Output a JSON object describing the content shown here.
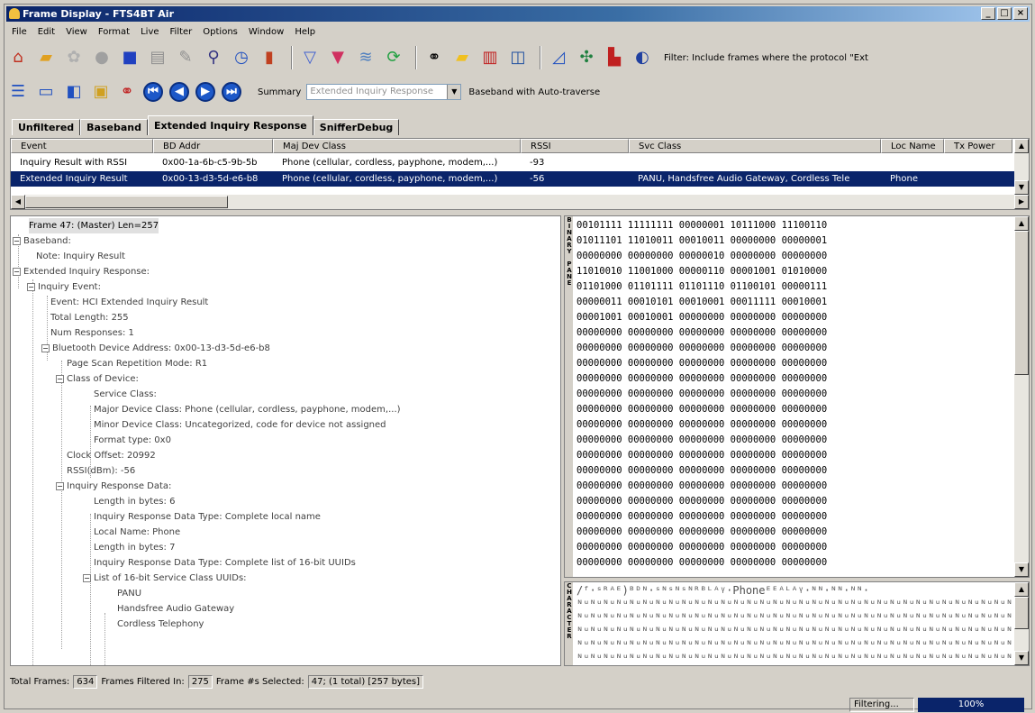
{
  "window": {
    "title": "Frame Display - FTS4BT Air",
    "controls": [
      "_",
      "□",
      "×"
    ]
  },
  "menu": [
    "File",
    "Edit",
    "View",
    "Format",
    "Live",
    "Filter",
    "Options",
    "Window",
    "Help"
  ],
  "toolbar1": {
    "filter_text": "Filter:  Include frames where the protocol \"Ext"
  },
  "toolbar2": {
    "summary_label": "Summary",
    "summary_value": "Extended Inquiry Response",
    "baseband_label": "Baseband with Auto-traverse"
  },
  "tabs": [
    "Unfiltered",
    "Baseband",
    "Extended Inquiry Response",
    "SnifferDebug"
  ],
  "grid": {
    "columns": [
      "Event",
      "BD Addr",
      "Maj Dev Class",
      "RSSI",
      "Svc Class",
      "Loc Name",
      "Tx Power"
    ],
    "rows": [
      {
        "event": "Inquiry Result with RSSI",
        "bdaddr": "0x00-1a-6b-c5-9b-5b",
        "majdev": "Phone (cellular, cordless, payphone, modem,...)",
        "rssi": "-93",
        "svc": "",
        "loc": "",
        "tx": ""
      },
      {
        "event": "Extended Inquiry Result",
        "bdaddr": "0x00-13-d3-5d-e6-b8",
        "majdev": "Phone (cellular, cordless, payphone, modem,...)",
        "rssi": "-56",
        "svc": "PANU, Handsfree Audio Gateway, Cordless Tele",
        "loc": "Phone",
        "tx": ""
      }
    ]
  },
  "tree": [
    "Frame 47: (Master) Len=257",
    "Baseband:",
    "Note: Inquiry Result",
    "Extended Inquiry Response:",
    "Inquiry Event:",
    "Event: HCI Extended Inquiry Result",
    "Total Length: 255",
    "Num Responses: 1",
    "Bluetooth Device Address: 0x00-13-d3-5d-e6-b8",
    "Page Scan Repetition Mode: R1",
    "Class of Device:",
    "Service Class:",
    "Major Device Class: Phone (cellular, cordless, payphone, modem,...)",
    "Minor Device Class: Uncategorized, code for device not assigned",
    "Format type: 0x0",
    "Clock Offset: 20992",
    "RSSI(dBm): -56",
    "Inquiry Response Data:",
    "Length in bytes: 6",
    "Inquiry Response Data Type: Complete local name",
    "Local Name: Phone",
    "Length in bytes: 7",
    "Inquiry Response Data Type: Complete list of 16-bit UUIDs",
    "List of 16-bit Service Class UUIDs:",
    "PANU",
    "Handsfree Audio Gateway",
    "Cordless Telephony"
  ],
  "binary_label": "BINARY PANE",
  "binary_lines": [
    "00101111 11111111 00000001 10111000 11100110",
    "01011101 11010011 00010011 00000000 00000001",
    "00000000 00000000 00000010 00000000 00000000",
    "11010010 11001000 00000110 00001001 01010000",
    "01101000 01101111 01101110 01100101 00000111",
    "00000011 00010101 00010001 00011111 00010001",
    "00001001 00010001 00000000 00000000 00000000",
    "00000000 00000000 00000000 00000000 00000000",
    "00000000 00000000 00000000 00000000 00000000",
    "00000000 00000000 00000000 00000000 00000000",
    "00000000 00000000 00000000 00000000 00000000",
    "00000000 00000000 00000000 00000000 00000000",
    "00000000 00000000 00000000 00000000 00000000",
    "00000000 00000000 00000000 00000000 00000000",
    "00000000 00000000 00000000 00000000 00000000",
    "00000000 00000000 00000000 00000000 00000000",
    "00000000 00000000 00000000 00000000 00000000",
    "00000000 00000000 00000000 00000000 00000000",
    "00000000 00000000 00000000 00000000 00000000",
    "00000000 00000000 00000000 00000000 00000000",
    "00000000 00000000 00000000 00000000 00000000",
    "00000000 00000000 00000000 00000000 00000000",
    "00000000 00000000 00000000 00000000 00000000"
  ],
  "character_label": "CHARACTER",
  "character_lines": [
    "/ᶠ·ˢᴿᴬᴱ)ᴮᴰᴺ·ˢᴺˢᴺˢᴺᴿᴮᴸᴬᵞ·Phoneᴱᴱᴬᴸᴬᵞ·ᴺᴺ·ᴺᴺ·ᴺᴺ·",
    "ᴺᵘᴺᵘᴺᵘᴺᵘᴺᵘᴺᵘᴺᵘᴺᵘᴺᵘᴺᵘᴺᵘᴺᵘᴺᵘᴺᵘᴺᵘᴺᵘᴺᵘᴺᵘᴺᵘᴺᵘᴺᵘᴺᵘᴺᵘᴺᵘᴺᵘᴺᵘᴺᵘᴺᵘᴺᵘᴺᵘᴺᵘᴺᵘᴺᵘᴺᵘᴺᵘ",
    "ᴺᵘᴺᵘᴺᵘᴺᵘᴺᵘᴺᵘᴺᵘᴺᵘᴺᵘᴺᵘᴺᵘᴺᵘᴺᵘᴺᵘᴺᵘᴺᵘᴺᵘᴺᵘᴺᵘᴺᵘᴺᵘᴺᵘᴺᵘᴺᵘᴺᵘᴺᵘᴺᵘᴺᵘᴺᵘᴺᵘᴺᵘᴺᵘᴺᵘᴺᵘᴺᵘ",
    "ᴺᵘᴺᵘᴺᵘᴺᵘᴺᵘᴺᵘᴺᵘᴺᵘᴺᵘᴺᵘᴺᵘᴺᵘᴺᵘᴺᵘᴺᵘᴺᵘᴺᵘᴺᵘᴺᵘᴺᵘᴺᵘᴺᵘᴺᵘᴺᵘᴺᵘᴺᵘᴺᵘᴺᵘᴺᵘᴺᵘᴺᵘᴺᵘᴺᵘᴺᵘᴺᵘ",
    "ᴺᵘᴺᵘᴺᵘᴺᵘᴺᵘᴺᵘᴺᵘᴺᵘᴺᵘᴺᵘᴺᵘᴺᵘᴺᵘᴺᵘᴺᵘᴺᵘᴺᵘᴺᵘᴺᵘᴺᵘᴺᵘᴺᵘᴺᵘᴺᵘᴺᵘᴺᵘᴺᵘᴺᵘᴺᵘᴺᵘᴺᵘᴺᵘᴺᵘᴺᵘᴺᵘ",
    "ᴺᵘᴺᵘᴺᵘᴺᵘᴺᵘᴺᵘᴺᵘᴺᵘᴺᵘᴺᵘᴺᵘᴺᵘᴺᵘᴺᵘᴺᵘᴺᵘᴺᵘᴺᵘᴺᵘᴺᵘᴺᵘᴺᵘᴺᵘᴺᵘᴺᵘᴺᵘᴺᵘᴺᵘᴺᵘᴺᵘᴺᵘᴺᵘᴺᵘᴺᵘᴺᵘ"
  ],
  "status": {
    "total_frames_label": "Total Frames:",
    "total_frames": "634",
    "filtered_label": "Frames Filtered In:",
    "filtered": "275",
    "selected_label": "Frame #s Selected:",
    "selected": "47; (1 total) [257 bytes]",
    "filtering_label": "Filtering...",
    "progress": "100%"
  }
}
